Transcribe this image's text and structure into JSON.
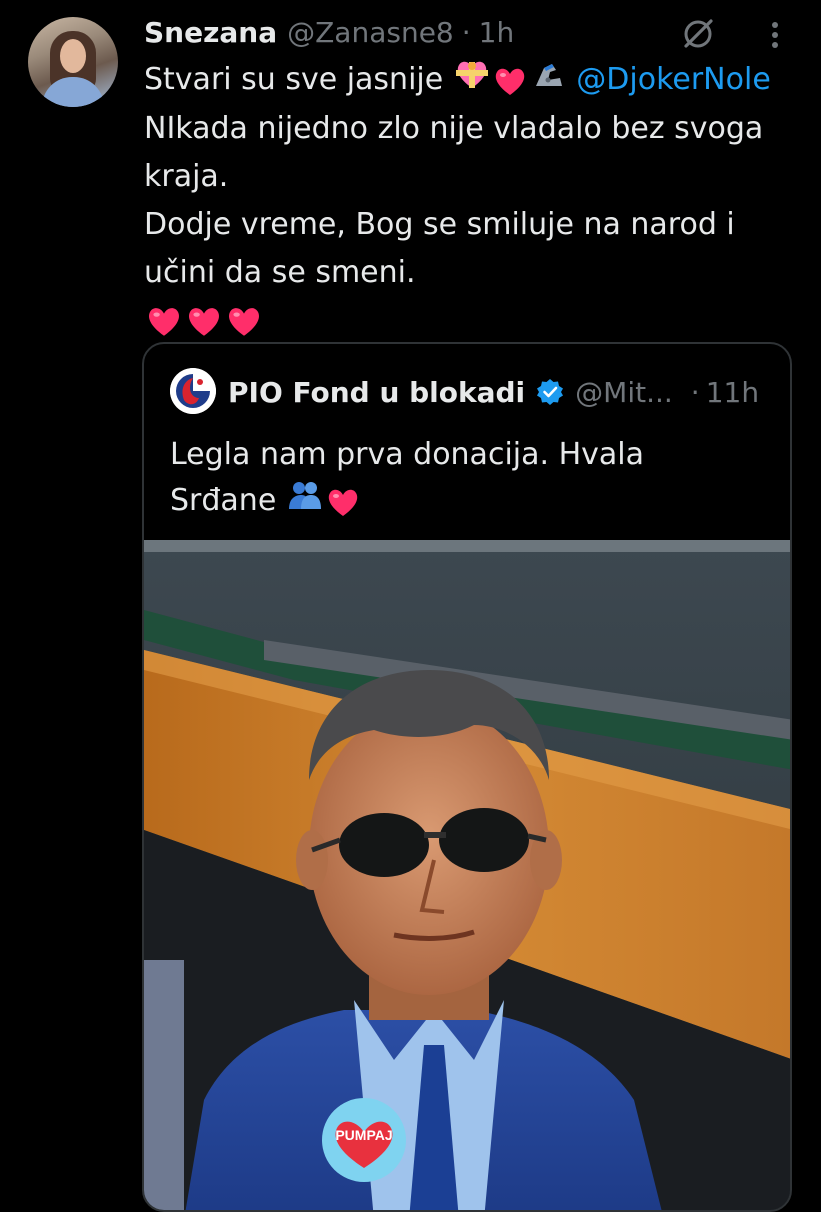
{
  "tweet": {
    "author": {
      "display_name": "Snezana",
      "handle": "@Zanasne8",
      "separator": "·",
      "time": "1h"
    },
    "lines": {
      "l1_text": "Stvari su sve jasnije",
      "l1_mention": "@DjokerNole",
      "l2": "NIkada nijedno zlo nije vladalo bez svoga",
      "l3": "kraja.",
      "l4": "Dodje vreme, Bog se smiluje na narod i",
      "l5": "učini da se smeni."
    },
    "emoji_l1": [
      "heart-with-ribbon",
      "red-heart",
      "mechanical-arm"
    ],
    "emoji_l6": [
      "red-heart",
      "red-heart",
      "red-heart"
    ]
  },
  "quoted": {
    "author": {
      "display_name": "PIO Fond u blokadi",
      "handle": "@Mit...",
      "separator": "·",
      "time": "11h"
    },
    "lines": {
      "l1": "Legla nam prva donacija. Hvala",
      "l2": "Srđane"
    },
    "emoji_l2": [
      "people-hugging",
      "red-heart"
    ],
    "sticker_text": "PUMPAJ"
  },
  "colors": {
    "background": "#000000",
    "text": "#e7e9ea",
    "muted": "#71767b",
    "link": "#1d9bf0",
    "border": "#2f3336",
    "verified": "#1d9bf0"
  }
}
